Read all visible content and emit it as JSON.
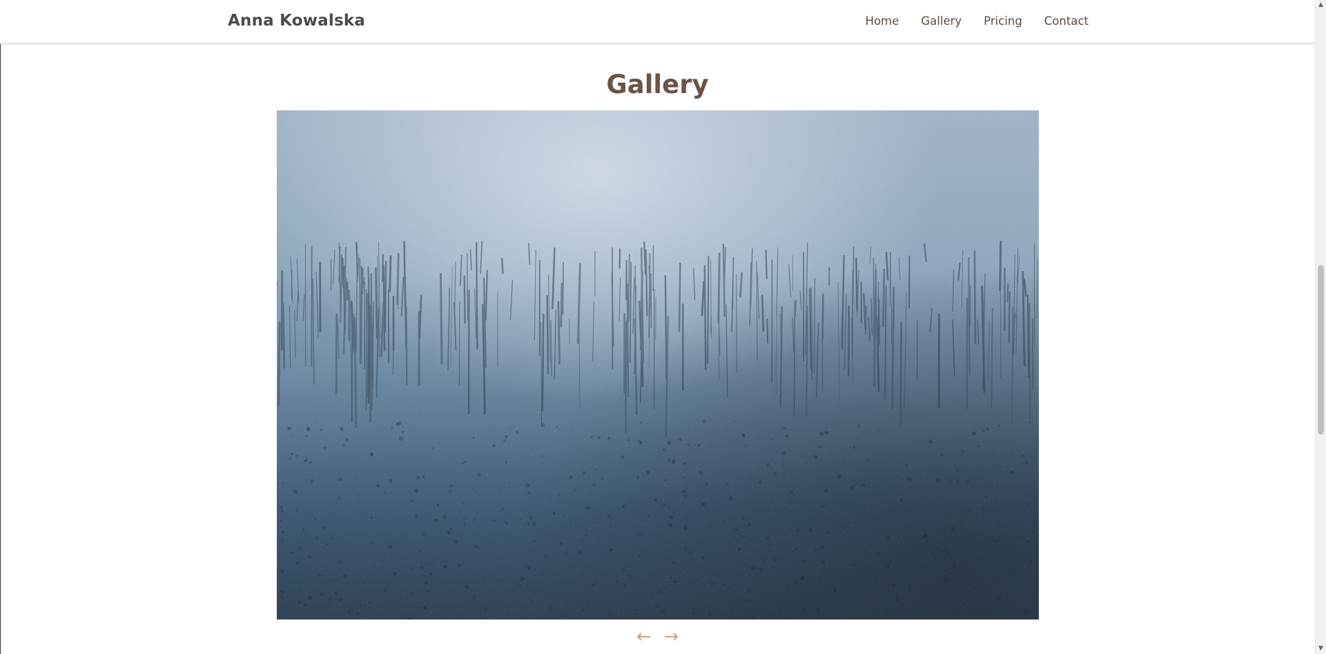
{
  "header": {
    "brand": "Anna Kowalska",
    "nav": [
      "Home",
      "Gallery",
      "Pricing",
      "Contact"
    ]
  },
  "gallery": {
    "title": "Gallery",
    "prev_icon": "arrow-left-icon",
    "next_icon": "arrow-right-icon",
    "prev_glyph": "←",
    "next_glyph": "→",
    "image_palette": [
      "#9fb3c8",
      "#5f7f9c",
      "#2f4f6d",
      "#1f3348"
    ]
  },
  "colors": {
    "brand_text": "#4d4a47",
    "nav_text": "#5d4a3c",
    "title_text": "#6b5446",
    "accent": "#c9a48b",
    "divider": "#d7bfb0"
  }
}
